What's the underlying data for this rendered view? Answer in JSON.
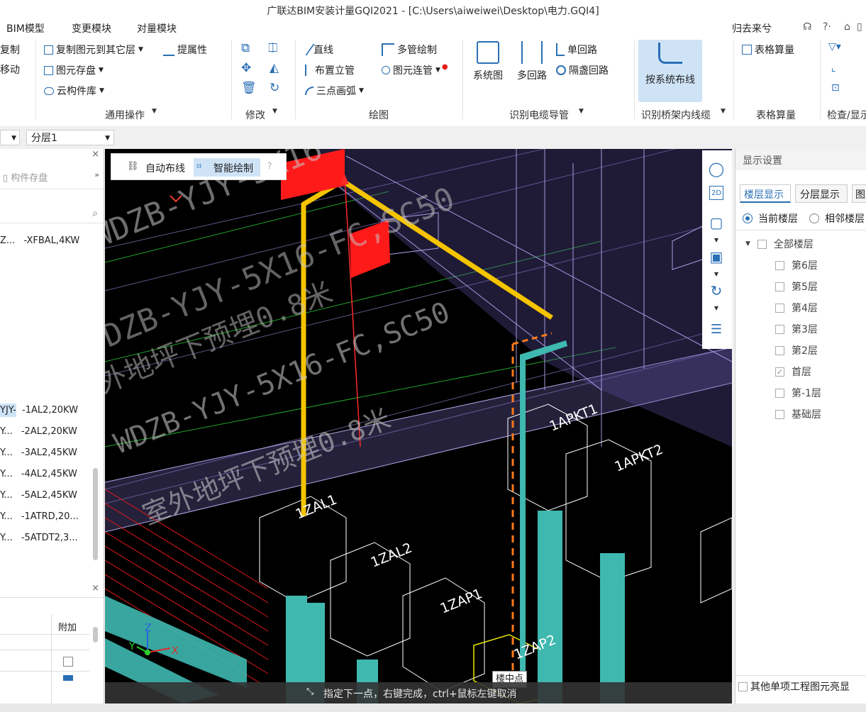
{
  "window": {
    "title": "广联达BIM安装计量GQI2021 - [C:\\Users\\aiweiwei\\Desktop\\电力.GQI4]"
  },
  "menubar": {
    "items": [
      "BIM模型",
      "变更模块",
      "对量模块"
    ],
    "right_label": "归去来兮"
  },
  "ribbon": {
    "left_cut": [
      "复制",
      "移动"
    ],
    "common_ops": {
      "items": [
        "复制图元到其它层",
        "提属性",
        "图元存盘",
        "云构件库"
      ],
      "label": "通用操作"
    },
    "modify": {
      "label": "修改"
    },
    "draw": {
      "items": [
        "直线",
        "多管绘制",
        "布置立管",
        "图元连管",
        "三点画弧"
      ],
      "label": "绘图"
    },
    "cable": {
      "items": [
        "系统图",
        "多回路",
        "单回路",
        "隔盏回路"
      ],
      "label": "识别电缆导管"
    },
    "tray": {
      "button": "按系统布线",
      "label": "识别桥架内线缆"
    },
    "table": {
      "button": "表格算量",
      "label": "表格算量"
    },
    "check": {
      "label": "检查/显示"
    }
  },
  "floor_combo": {
    "selected": "分层1"
  },
  "left_panel": {
    "tab": "构件存盘",
    "rows": [
      {
        "left": "Z...",
        "right": "-XFBAL,4KW"
      },
      {
        "left": "YJY-",
        "right": "-1AL2,20KW"
      },
      {
        "left": "Y...",
        "right": "-2AL2,20KW"
      },
      {
        "left": "Y...",
        "right": "-3AL2,45KW"
      },
      {
        "left": "Y...",
        "right": "-4AL2,45KW"
      },
      {
        "left": "Y...",
        "right": "-5AL2,45KW"
      },
      {
        "left": "Y...",
        "right": "-1ATRD,20..."
      },
      {
        "left": "Y...",
        "right": "-5ATDT2,3..."
      }
    ],
    "lower_header": "附加"
  },
  "viewport": {
    "toolbar": {
      "auto": "自动布线",
      "smart": "智能绘制"
    },
    "labels": [
      "1ZAL1",
      "1ZAL2",
      "1ZAP1",
      "1ZAP2",
      "1APKT1",
      "1APKT2"
    ],
    "snap_tip": "楼中点",
    "hint": "指定下一点，右键完成，ctrl+鼠标左键取消",
    "annotations": [
      "WDZB-YJY-5X16-FC,SC50",
      "室外地坪下预埋0.8米"
    ]
  },
  "right_panel": {
    "title": "显示设置",
    "tabs": [
      "楼层显示",
      "分层显示",
      "图"
    ],
    "radio_current": "当前楼层",
    "radio_adjacent": "相邻楼层",
    "all_floors": "全部楼层",
    "floors": [
      {
        "name": "第6层",
        "checked": false
      },
      {
        "name": "第5层",
        "checked": false
      },
      {
        "name": "第4层",
        "checked": false
      },
      {
        "name": "第3层",
        "checked": false
      },
      {
        "name": "第2层",
        "checked": false
      },
      {
        "name": "首层",
        "checked": true
      },
      {
        "name": "第-1层",
        "checked": false
      },
      {
        "name": "基础层",
        "checked": false
      }
    ],
    "bottom_check": "其他单项工程图元亮显"
  },
  "colors": {
    "accent": "#2a6fb5",
    "pipe_yellow": "#f5c400",
    "pipe_cyan": "#3fb8b0",
    "red_box": "#ff1a1a",
    "selected_tab_bg": "#cfe3f7"
  }
}
